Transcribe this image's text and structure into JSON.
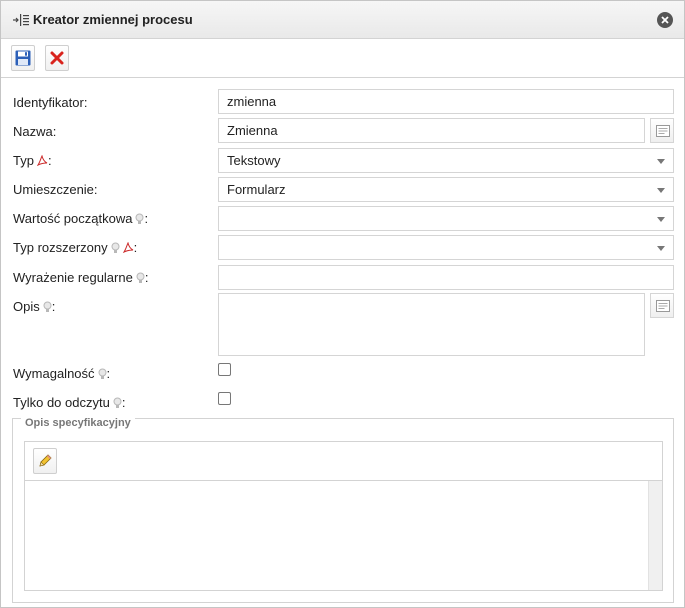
{
  "dialog": {
    "title": "Kreator zmiennej procesu",
    "title_icon": "variable-icon",
    "close_icon": "close-icon"
  },
  "toolbar": {
    "save_icon": "floppy-disk-icon",
    "cancel_icon": "red-x-icon"
  },
  "form": {
    "identyfikator": {
      "label": "Identyfikator:",
      "value": "zmienna"
    },
    "nazwa": {
      "label": "Nazwa:",
      "value": "Zmienna"
    },
    "typ": {
      "label_prefix": "Typ",
      "label_suffix": ":",
      "value": "Tekstowy"
    },
    "umieszczenie": {
      "label": "Umieszczenie:",
      "value": "Formularz"
    },
    "wartosc": {
      "label_prefix": "Wartość początkowa",
      "label_suffix": ":",
      "value": ""
    },
    "typ_rozszerzony": {
      "label_prefix": "Typ rozszerzony",
      "label_suffix": ":",
      "value": ""
    },
    "wyrazenie": {
      "label_prefix": "Wyrażenie regularne",
      "label_suffix": ":",
      "value": ""
    },
    "opis": {
      "label_prefix": "Opis",
      "label_suffix": ":",
      "value": ""
    },
    "wymagalnosc": {
      "label_prefix": "Wymagalność",
      "label_suffix": ":",
      "checked": false
    },
    "tylko_odczyt": {
      "label_prefix": "Tylko do odczytu",
      "label_suffix": ":",
      "checked": false
    }
  },
  "spec": {
    "legend": "Opis specyfikacyjny",
    "edit_icon": "pencil-icon",
    "content": ""
  },
  "colors": {
    "save_blue": "#2b5fb8",
    "cancel_red": "#d9231d",
    "pdf_red": "#cc2b2b",
    "hint_gray": "#b8b8b8"
  }
}
